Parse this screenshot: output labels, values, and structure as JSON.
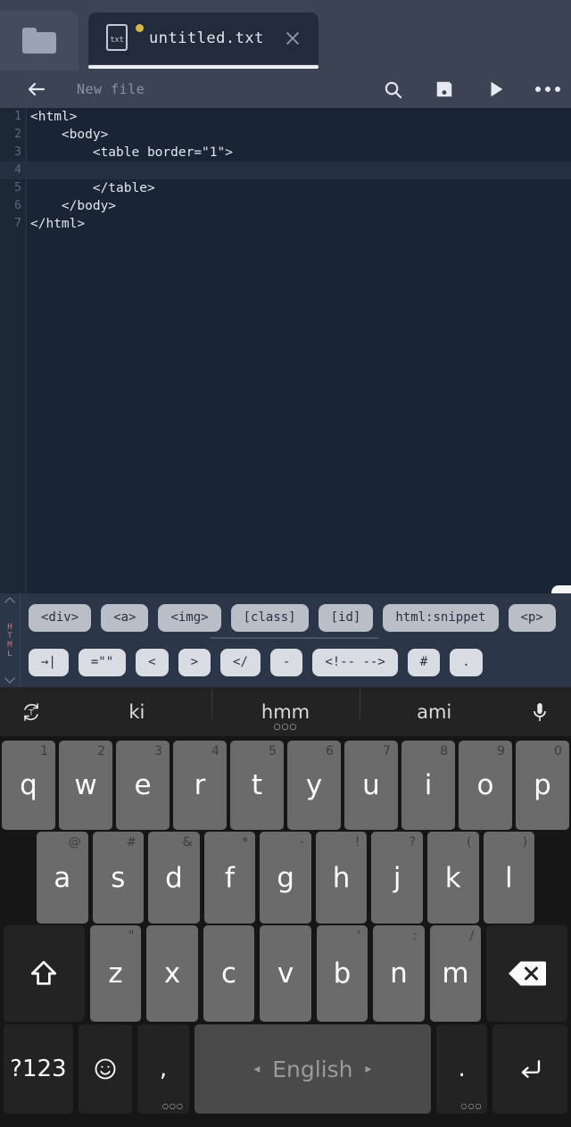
{
  "tabbar": {
    "folder_icon": "folder-icon",
    "tab": {
      "file_ext": "txt",
      "title": "untitled.txt",
      "modified_dot": "unsaved-indicator",
      "close_icon": "close-icon"
    }
  },
  "toolbar": {
    "back_icon": "back-arrow-icon",
    "title": "New file",
    "actions": [
      {
        "name": "search-icon"
      },
      {
        "name": "save-icon"
      },
      {
        "name": "run-icon"
      },
      {
        "name": "overflow-menu-icon"
      }
    ]
  },
  "editor": {
    "active_line": 4,
    "lines": [
      {
        "n": "1",
        "text": "<html>"
      },
      {
        "n": "2",
        "text": "    <body>"
      },
      {
        "n": "3",
        "text": "        <table border=\"1\">"
      },
      {
        "n": "4",
        "text": ""
      },
      {
        "n": "5",
        "text": "        </table>"
      },
      {
        "n": "6",
        "text": "    </body>"
      },
      {
        "n": "7",
        "text": "</html>"
      }
    ],
    "side_handle_icon": "chevron-left-icon"
  },
  "snippet_bar": {
    "language_label": "HTML",
    "scroll_up_icon": "chevron-up-icon",
    "scroll_down_icon": "chevron-down-icon",
    "row1": [
      "<div>",
      "<a>",
      "<img>",
      "[class]",
      "[id]",
      "html:snippet",
      "<p>"
    ],
    "row2": [
      "→|",
      "=\"\"",
      "<",
      ">",
      "</",
      "-",
      "<!-- -->",
      "#",
      "."
    ]
  },
  "suggestions": {
    "left_icon": "translate-refresh-icon",
    "words": [
      "ki",
      "hmm",
      "ami"
    ],
    "center_more": "○○○",
    "mic_icon": "microphone-icon"
  },
  "keyboard": {
    "row1": [
      {
        "key": "q",
        "hint": "1"
      },
      {
        "key": "w",
        "hint": "2"
      },
      {
        "key": "e",
        "hint": "3"
      },
      {
        "key": "r",
        "hint": "4"
      },
      {
        "key": "t",
        "hint": "5"
      },
      {
        "key": "y",
        "hint": "6"
      },
      {
        "key": "u",
        "hint": "7"
      },
      {
        "key": "i",
        "hint": "8"
      },
      {
        "key": "o",
        "hint": "9"
      },
      {
        "key": "p",
        "hint": "0"
      }
    ],
    "row2": [
      {
        "key": "a",
        "hint": "@"
      },
      {
        "key": "s",
        "hint": "#"
      },
      {
        "key": "d",
        "hint": "&"
      },
      {
        "key": "f",
        "hint": "*"
      },
      {
        "key": "g",
        "hint": "-"
      },
      {
        "key": "h",
        "hint": "!"
      },
      {
        "key": "j",
        "hint": "?"
      },
      {
        "key": "k",
        "hint": "("
      },
      {
        "key": "l",
        "hint": ")"
      }
    ],
    "row3": {
      "shift": "shift-key",
      "letters": [
        {
          "key": "z",
          "hint": "\""
        },
        {
          "key": "x",
          "hint": ""
        },
        {
          "key": "c",
          "hint": ""
        },
        {
          "key": "v",
          "hint": ""
        },
        {
          "key": "b",
          "hint": "'"
        },
        {
          "key": "n",
          "hint": ":"
        },
        {
          "key": "m",
          "hint": "/"
        }
      ],
      "backspace": "backspace-key"
    },
    "row4": {
      "symbols": "?123",
      "emoji": "☺",
      "comma": ",",
      "space_label": "English",
      "space_prev": "◂",
      "space_next": "▸",
      "period": ".",
      "enter": "↵",
      "more_dots": "○○○"
    }
  }
}
